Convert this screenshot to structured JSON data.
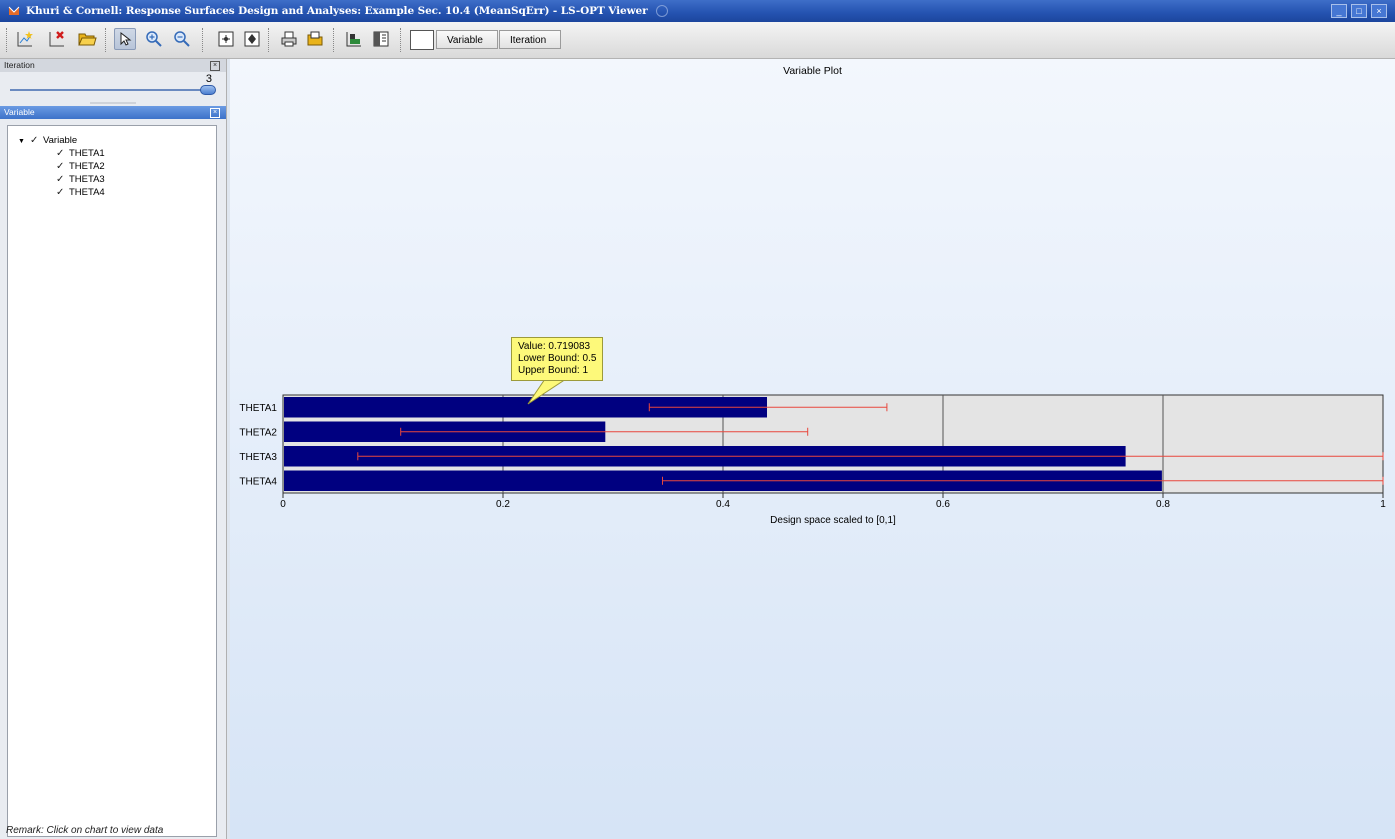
{
  "window": {
    "title": "Khuri & Cornell: Response Surfaces Design and Analyses: Example Sec. 10.4 (MeanSqErr) - LS-OPT Viewer",
    "minimize_glyph": "_",
    "maximize_glyph": "□",
    "close_glyph": "×"
  },
  "toolbar": {
    "icons": [
      "new-plot-icon",
      "delete-plot-icon",
      "open-folder-icon",
      "pointer-icon",
      "zoom-in-icon",
      "zoom-out-icon",
      "move-up-icon",
      "move-down-icon",
      "print-icon",
      "export-icon",
      "palette-icon",
      "layout-icon"
    ],
    "tabs": [
      "Variable",
      "Iteration"
    ]
  },
  "iteration_panel": {
    "header": "Iteration",
    "value": "3",
    "close_glyph": "×"
  },
  "variable_panel": {
    "header": "Variable",
    "close_glyph": "×",
    "tree": {
      "root": "Variable",
      "children": [
        "THETA1",
        "THETA2",
        "THETA3",
        "THETA4"
      ]
    }
  },
  "remark": "Remark: Click on chart to view data",
  "plot": {
    "title": "Variable Plot",
    "tooltip": {
      "line1": "Value: 0.719083",
      "line2": "Lower Bound: 0.5",
      "line3": "Upper Bound: 1"
    }
  },
  "colors": {
    "bar": "#000080",
    "error_bar": "#e8473c",
    "plot_bg": "#e4e4e4",
    "title_bar": "#2452b0"
  },
  "chart_data": {
    "type": "bar",
    "orientation": "horizontal",
    "title": "Variable Plot",
    "xlabel": "Design space scaled to [0,1]",
    "ylabel": "",
    "xlim": [
      0,
      1
    ],
    "xticks": [
      "0",
      "0.2",
      "0.4",
      "0.6",
      "0.8",
      "1"
    ],
    "grid": true,
    "categories": [
      "THETA1",
      "THETA2",
      "THETA3",
      "THETA4"
    ],
    "values": [
      0.44,
      0.293,
      0.766,
      0.799
    ],
    "ranges": [
      [
        0.333,
        0.549
      ],
      [
        0.107,
        0.477
      ],
      [
        0.068,
        1.0
      ],
      [
        0.345,
        1.0
      ]
    ]
  }
}
